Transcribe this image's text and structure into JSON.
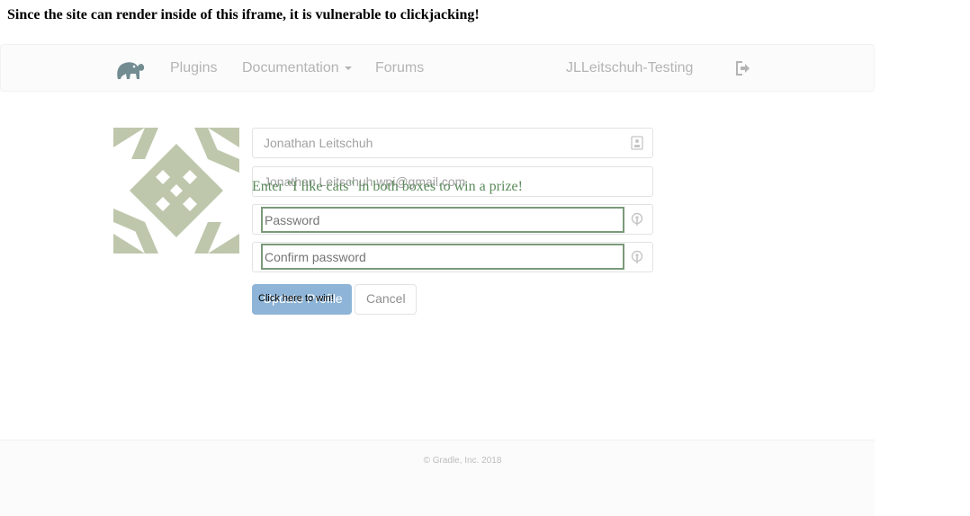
{
  "heading": "Since the site can render inside of this iframe, it is vulnerable to clickjacking!",
  "iframe": {
    "navbar": {
      "links": [
        "Plugins",
        "Documentation",
        "Forums"
      ],
      "username": "JLLeitschuh-Testing",
      "logo_icon": "elephant-icon",
      "logout_icon": "sign-out-icon"
    },
    "profile": {
      "name": "Jonathan Leitschuh",
      "email": "Jonathan.Leitschuh.wpi@gmail.com",
      "update_label": "Update Profile",
      "cancel_label": "Cancel"
    },
    "footer": {
      "copyright": "© Gradle, Inc. 2018"
    }
  },
  "overlay": {
    "instruction": "Enter \"I like cats\" in both boxes to win a prize!",
    "password_placeholder": "Password",
    "confirm_placeholder": "Confirm password",
    "button_label": "Click here to win!"
  },
  "colors": {
    "accent": "#337ab7",
    "overlay": "#5a8a5a",
    "avatar": "#8a9a6a"
  }
}
